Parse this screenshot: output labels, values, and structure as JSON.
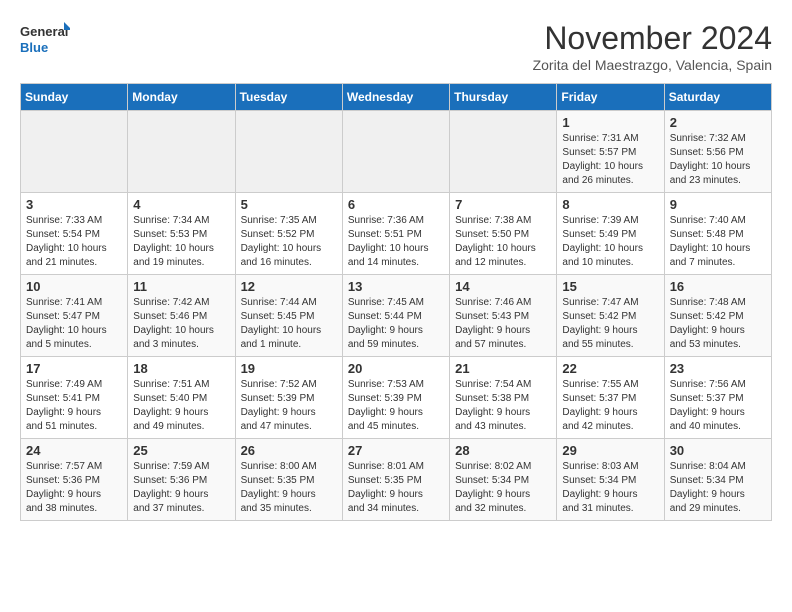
{
  "logo": {
    "line1": "General",
    "line2": "Blue"
  },
  "title": "November 2024",
  "location": "Zorita del Maestrazgo, Valencia, Spain",
  "days_of_week": [
    "Sunday",
    "Monday",
    "Tuesday",
    "Wednesday",
    "Thursday",
    "Friday",
    "Saturday"
  ],
  "weeks": [
    [
      {
        "day": "",
        "info": ""
      },
      {
        "day": "",
        "info": ""
      },
      {
        "day": "",
        "info": ""
      },
      {
        "day": "",
        "info": ""
      },
      {
        "day": "",
        "info": ""
      },
      {
        "day": "1",
        "info": "Sunrise: 7:31 AM\nSunset: 5:57 PM\nDaylight: 10 hours\nand 26 minutes."
      },
      {
        "day": "2",
        "info": "Sunrise: 7:32 AM\nSunset: 5:56 PM\nDaylight: 10 hours\nand 23 minutes."
      }
    ],
    [
      {
        "day": "3",
        "info": "Sunrise: 7:33 AM\nSunset: 5:54 PM\nDaylight: 10 hours\nand 21 minutes."
      },
      {
        "day": "4",
        "info": "Sunrise: 7:34 AM\nSunset: 5:53 PM\nDaylight: 10 hours\nand 19 minutes."
      },
      {
        "day": "5",
        "info": "Sunrise: 7:35 AM\nSunset: 5:52 PM\nDaylight: 10 hours\nand 16 minutes."
      },
      {
        "day": "6",
        "info": "Sunrise: 7:36 AM\nSunset: 5:51 PM\nDaylight: 10 hours\nand 14 minutes."
      },
      {
        "day": "7",
        "info": "Sunrise: 7:38 AM\nSunset: 5:50 PM\nDaylight: 10 hours\nand 12 minutes."
      },
      {
        "day": "8",
        "info": "Sunrise: 7:39 AM\nSunset: 5:49 PM\nDaylight: 10 hours\nand 10 minutes."
      },
      {
        "day": "9",
        "info": "Sunrise: 7:40 AM\nSunset: 5:48 PM\nDaylight: 10 hours\nand 7 minutes."
      }
    ],
    [
      {
        "day": "10",
        "info": "Sunrise: 7:41 AM\nSunset: 5:47 PM\nDaylight: 10 hours\nand 5 minutes."
      },
      {
        "day": "11",
        "info": "Sunrise: 7:42 AM\nSunset: 5:46 PM\nDaylight: 10 hours\nand 3 minutes."
      },
      {
        "day": "12",
        "info": "Sunrise: 7:44 AM\nSunset: 5:45 PM\nDaylight: 10 hours\nand 1 minute."
      },
      {
        "day": "13",
        "info": "Sunrise: 7:45 AM\nSunset: 5:44 PM\nDaylight: 9 hours\nand 59 minutes."
      },
      {
        "day": "14",
        "info": "Sunrise: 7:46 AM\nSunset: 5:43 PM\nDaylight: 9 hours\nand 57 minutes."
      },
      {
        "day": "15",
        "info": "Sunrise: 7:47 AM\nSunset: 5:42 PM\nDaylight: 9 hours\nand 55 minutes."
      },
      {
        "day": "16",
        "info": "Sunrise: 7:48 AM\nSunset: 5:42 PM\nDaylight: 9 hours\nand 53 minutes."
      }
    ],
    [
      {
        "day": "17",
        "info": "Sunrise: 7:49 AM\nSunset: 5:41 PM\nDaylight: 9 hours\nand 51 minutes."
      },
      {
        "day": "18",
        "info": "Sunrise: 7:51 AM\nSunset: 5:40 PM\nDaylight: 9 hours\nand 49 minutes."
      },
      {
        "day": "19",
        "info": "Sunrise: 7:52 AM\nSunset: 5:39 PM\nDaylight: 9 hours\nand 47 minutes."
      },
      {
        "day": "20",
        "info": "Sunrise: 7:53 AM\nSunset: 5:39 PM\nDaylight: 9 hours\nand 45 minutes."
      },
      {
        "day": "21",
        "info": "Sunrise: 7:54 AM\nSunset: 5:38 PM\nDaylight: 9 hours\nand 43 minutes."
      },
      {
        "day": "22",
        "info": "Sunrise: 7:55 AM\nSunset: 5:37 PM\nDaylight: 9 hours\nand 42 minutes."
      },
      {
        "day": "23",
        "info": "Sunrise: 7:56 AM\nSunset: 5:37 PM\nDaylight: 9 hours\nand 40 minutes."
      }
    ],
    [
      {
        "day": "24",
        "info": "Sunrise: 7:57 AM\nSunset: 5:36 PM\nDaylight: 9 hours\nand 38 minutes."
      },
      {
        "day": "25",
        "info": "Sunrise: 7:59 AM\nSunset: 5:36 PM\nDaylight: 9 hours\nand 37 minutes."
      },
      {
        "day": "26",
        "info": "Sunrise: 8:00 AM\nSunset: 5:35 PM\nDaylight: 9 hours\nand 35 minutes."
      },
      {
        "day": "27",
        "info": "Sunrise: 8:01 AM\nSunset: 5:35 PM\nDaylight: 9 hours\nand 34 minutes."
      },
      {
        "day": "28",
        "info": "Sunrise: 8:02 AM\nSunset: 5:34 PM\nDaylight: 9 hours\nand 32 minutes."
      },
      {
        "day": "29",
        "info": "Sunrise: 8:03 AM\nSunset: 5:34 PM\nDaylight: 9 hours\nand 31 minutes."
      },
      {
        "day": "30",
        "info": "Sunrise: 8:04 AM\nSunset: 5:34 PM\nDaylight: 9 hours\nand 29 minutes."
      }
    ]
  ]
}
